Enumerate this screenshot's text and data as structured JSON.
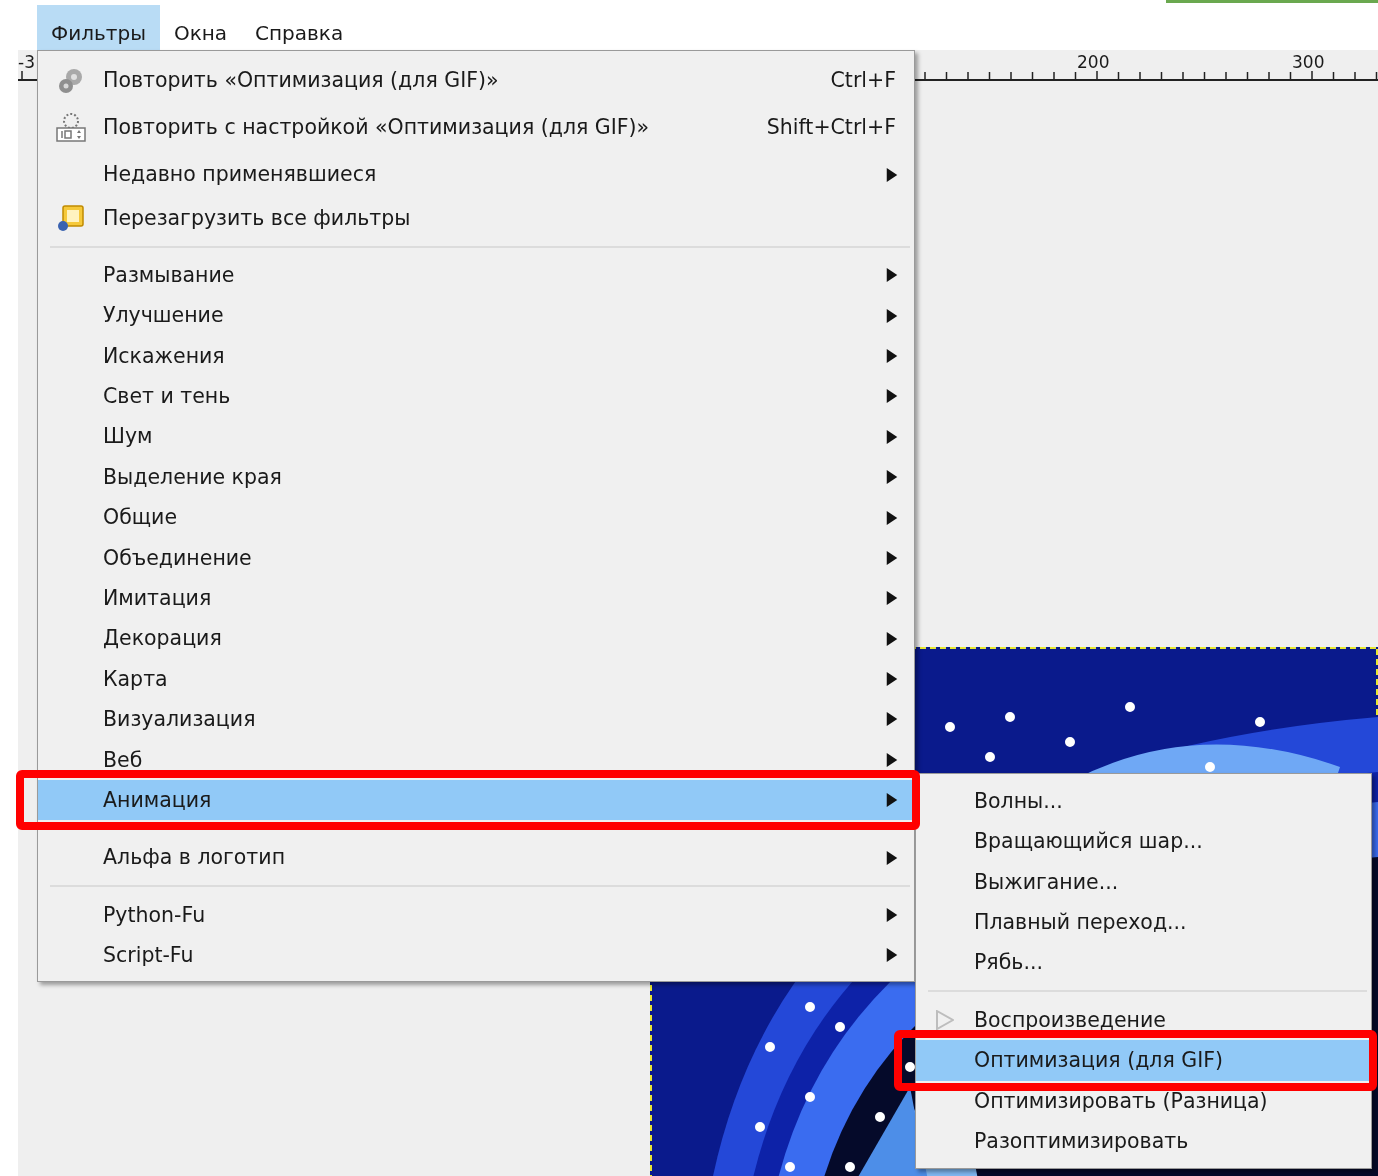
{
  "menubar": [
    {
      "label": "Фильтры",
      "selected": true
    },
    {
      "label": "Окна",
      "selected": false
    },
    {
      "label": "Справка",
      "selected": false
    }
  ],
  "ruler": {
    "labels": [
      "-3",
      "200",
      "300"
    ]
  },
  "filters_menu": {
    "items": [
      {
        "kind": "repeat",
        "label": "Повторить «Оптимизация (для GIF)»",
        "shortcut": "Ctrl+F",
        "submenu": false,
        "selected": false,
        "marked": false
      },
      {
        "kind": "reshow",
        "label": "Повторить с настройкой «Оптимизация (для GIF)»",
        "shortcut": "Shift+Ctrl+F",
        "submenu": false,
        "selected": false,
        "marked": false
      },
      {
        "kind": "plain",
        "label": "Недавно применявшиеся",
        "submenu": true,
        "selected": false,
        "marked": false
      },
      {
        "kind": "reload",
        "label": "Перезагрузить все фильтры",
        "submenu": false,
        "selected": false,
        "marked": false
      },
      {
        "kind": "separator"
      },
      {
        "kind": "plain",
        "label": "Размывание",
        "submenu": true,
        "selected": false,
        "marked": false
      },
      {
        "kind": "plain",
        "label": "Улучшение",
        "submenu": true,
        "selected": false,
        "marked": false
      },
      {
        "kind": "plain",
        "label": "Искажения",
        "submenu": true,
        "selected": false,
        "marked": false
      },
      {
        "kind": "plain",
        "label": "Свет и тень",
        "submenu": true,
        "selected": false,
        "marked": false
      },
      {
        "kind": "plain",
        "label": "Шум",
        "submenu": true,
        "selected": false,
        "marked": false
      },
      {
        "kind": "plain",
        "label": "Выделение края",
        "submenu": true,
        "selected": false,
        "marked": false
      },
      {
        "kind": "plain",
        "label": "Общие",
        "submenu": true,
        "selected": false,
        "marked": false
      },
      {
        "kind": "plain",
        "label": "Объединение",
        "submenu": true,
        "selected": false,
        "marked": false
      },
      {
        "kind": "plain",
        "label": "Имитация",
        "submenu": true,
        "selected": false,
        "marked": false
      },
      {
        "kind": "plain",
        "label": "Декорация",
        "submenu": true,
        "selected": false,
        "marked": false
      },
      {
        "kind": "plain",
        "label": "Карта",
        "submenu": true,
        "selected": false,
        "marked": false
      },
      {
        "kind": "plain",
        "label": "Визуализация",
        "submenu": true,
        "selected": false,
        "marked": false
      },
      {
        "kind": "plain",
        "label": "Веб",
        "submenu": true,
        "selected": false,
        "marked": false
      },
      {
        "kind": "plain",
        "label": "Анимация",
        "submenu": true,
        "selected": true,
        "marked": true
      },
      {
        "kind": "separator"
      },
      {
        "kind": "plain",
        "label": "Альфа в логотип",
        "submenu": true,
        "selected": false,
        "marked": false
      },
      {
        "kind": "separator"
      },
      {
        "kind": "plain",
        "label": "Python-Fu",
        "submenu": true,
        "selected": false,
        "marked": false
      },
      {
        "kind": "plain",
        "label": "Script-Fu",
        "submenu": true,
        "selected": false,
        "marked": false
      }
    ]
  },
  "animation_submenu": {
    "items": [
      {
        "kind": "plain",
        "label": "Волны...",
        "submenu": false,
        "selected": false,
        "marked": false
      },
      {
        "kind": "plain",
        "label": "Вращающийся шар...",
        "submenu": false,
        "selected": false,
        "marked": false
      },
      {
        "kind": "plain",
        "label": "Выжигание...",
        "submenu": false,
        "selected": false,
        "marked": false
      },
      {
        "kind": "plain",
        "label": "Плавный переход...",
        "submenu": false,
        "selected": false,
        "marked": false
      },
      {
        "kind": "plain",
        "label": "Рябь...",
        "submenu": false,
        "selected": false,
        "marked": false
      },
      {
        "kind": "separator"
      },
      {
        "kind": "playback",
        "label": "Воспроизведение",
        "submenu": false,
        "selected": false,
        "marked": false
      },
      {
        "kind": "plain",
        "label": "Оптимизация (для GIF)",
        "submenu": false,
        "selected": true,
        "marked": true
      },
      {
        "kind": "plain",
        "label": "Оптимизировать (Разница)",
        "submenu": false,
        "selected": false,
        "marked": false
      },
      {
        "kind": "plain",
        "label": "Разоптимизировать",
        "submenu": false,
        "selected": false,
        "marked": false
      }
    ]
  }
}
